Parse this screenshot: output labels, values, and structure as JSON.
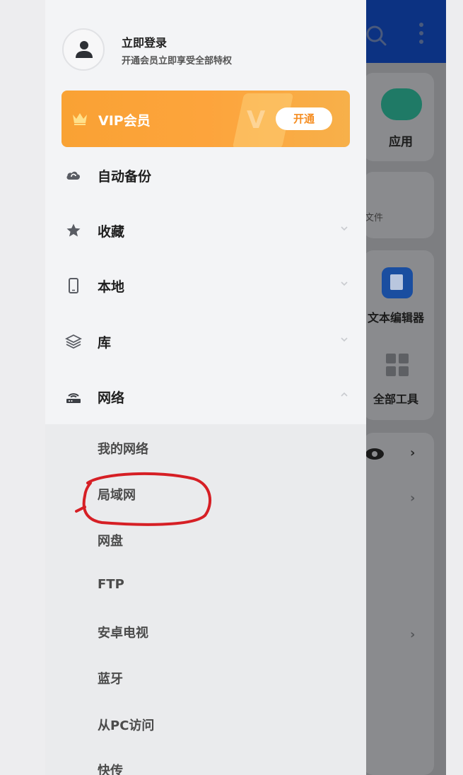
{
  "background_app": {
    "app_label": "应用",
    "files_label": "文件",
    "text_editor_label": "文本编辑器",
    "all_tools_label": "全部工具"
  },
  "drawer": {
    "login_title": "立即登录",
    "login_subtitle": "开通会员立即享受全部特权",
    "vip_label": "VIP会员",
    "vip_button": "开通",
    "items": [
      {
        "label": "自动备份",
        "icon": "cloud-sync-icon"
      },
      {
        "label": "收藏",
        "icon": "star-icon"
      },
      {
        "label": "本地",
        "icon": "phone-icon"
      },
      {
        "label": "库",
        "icon": "layers-icon"
      },
      {
        "label": "网络",
        "icon": "router-icon"
      }
    ],
    "network_subitems": [
      "我的网络",
      "局域网",
      "网盘",
      "FTP",
      "安卓电视",
      "蓝牙",
      "从PC访问",
      "快传"
    ]
  },
  "colors": {
    "topbar": "#0c3282",
    "vip_orange": "#f9a234",
    "annotation_red": "#d61f25"
  }
}
